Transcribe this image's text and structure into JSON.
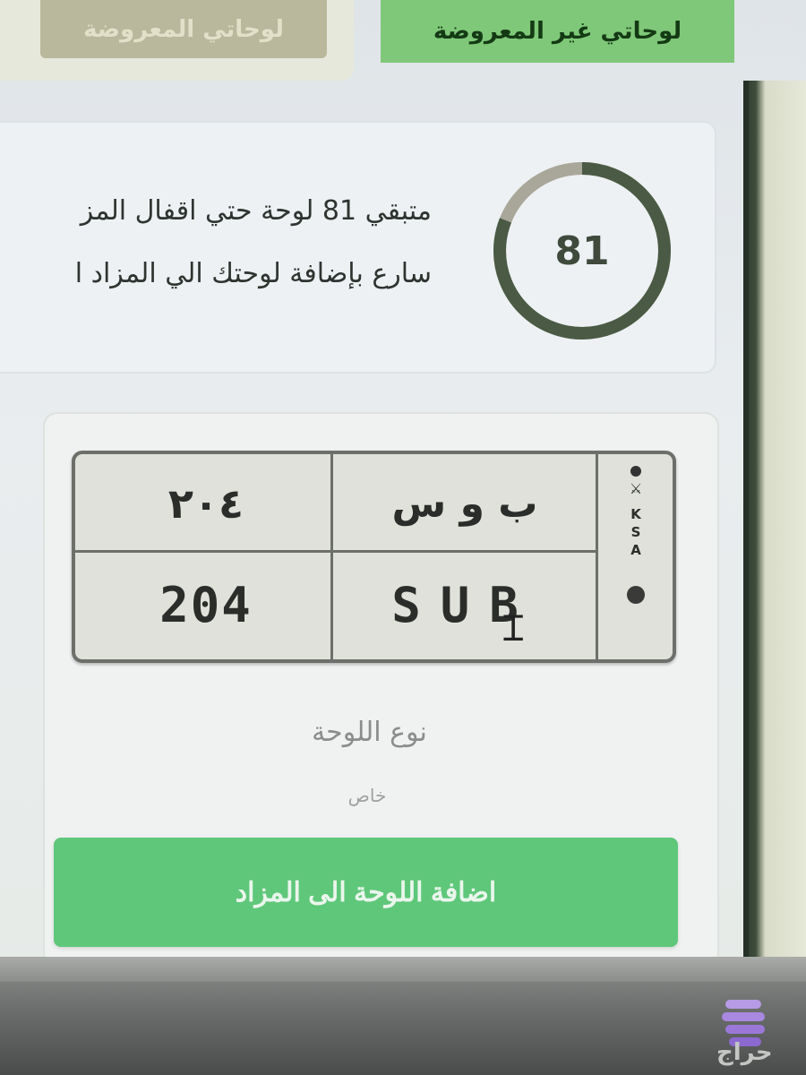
{
  "tabs": {
    "known_label": "لوحاتي المعروضة",
    "unknown_label": "لوحاتي غير المعروضة"
  },
  "counter": {
    "value": "81",
    "line1": "متبقي 81 لوحة حتي اقفال المز",
    "line2": "سارع بإضافة لوحتك الي المزاد ا",
    "ring_progress_fraction": 0.81,
    "colors": {
      "ring_fill": "#4a5a44",
      "ring_track": "#a8a79a"
    }
  },
  "plate": {
    "arabic_numbers": "٢٠٤",
    "arabic_letters": "ب و س",
    "english_numbers": "204",
    "english_letters": "SUB",
    "country_letters": [
      "K",
      "S",
      "A"
    ]
  },
  "plate_type": {
    "label": "نوع اللوحة",
    "value": "خاص"
  },
  "add_button": {
    "label": "اضافة اللوحة الى المزاد"
  },
  "watermark": {
    "text": "حراج"
  },
  "colors": {
    "accent_green": "#5fc77a",
    "tab_active": "#7fc879"
  }
}
